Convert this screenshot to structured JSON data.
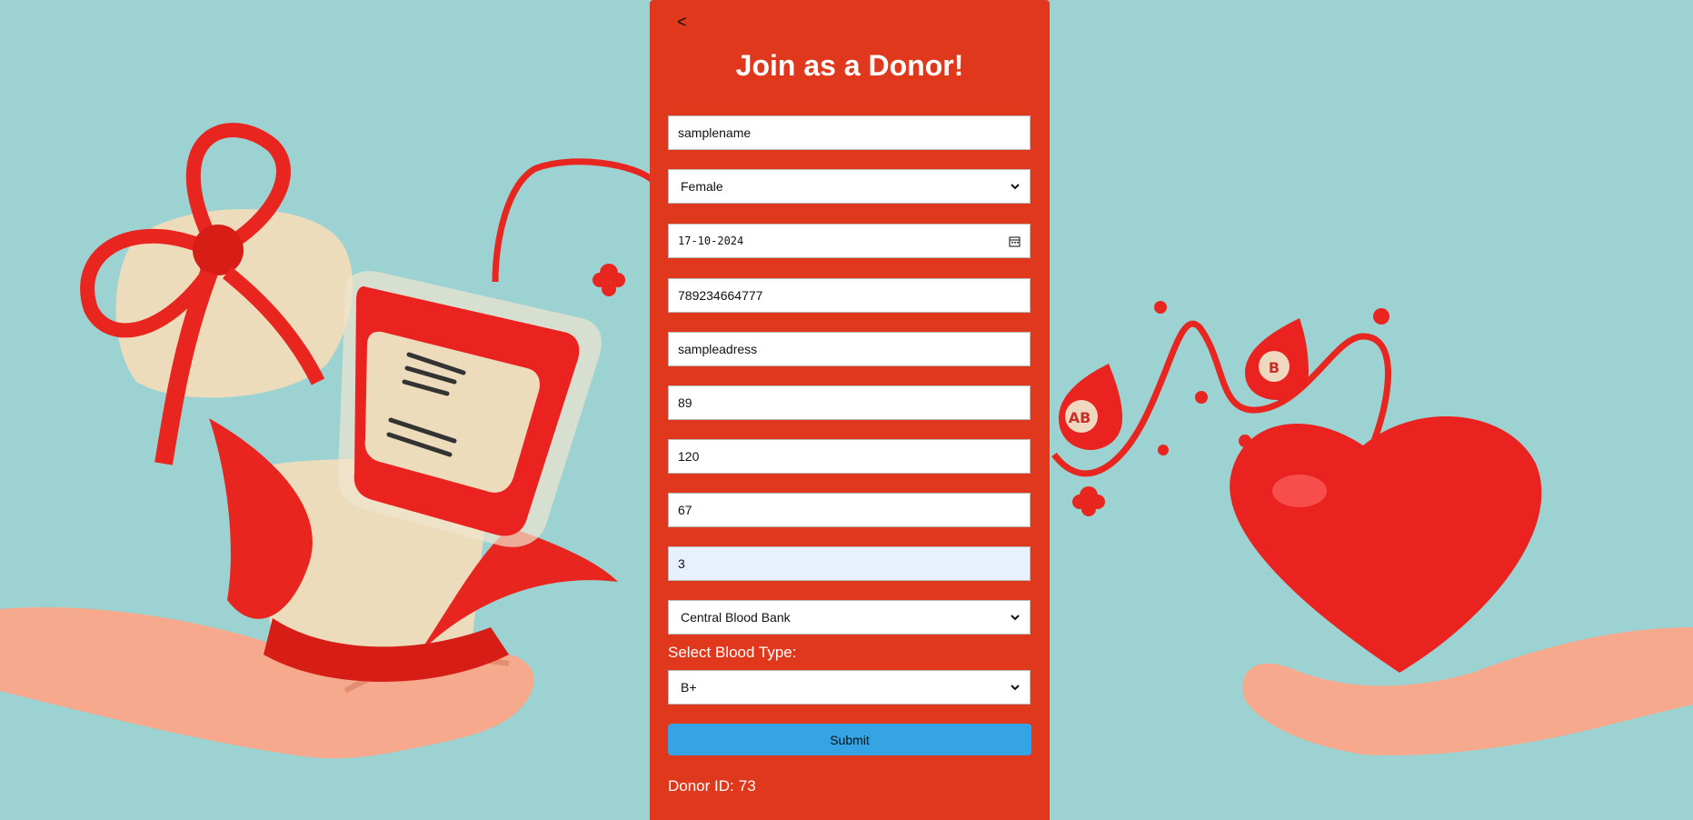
{
  "back_label": "<",
  "title": "Join as a Donor!",
  "form": {
    "name": "samplename",
    "gender": "Female",
    "date": "17-10-2024",
    "phone": "789234664777",
    "address": "sampleadress",
    "field_6": "89",
    "field_7": "120",
    "field_8": "67",
    "field_9": "3",
    "blood_bank": "Central Blood Bank",
    "blood_type_label": "Select Blood Type:",
    "blood_type": "B+",
    "submit_label": "Submit"
  },
  "donor_id": {
    "label": "Donor ID:",
    "value": "73"
  },
  "colors": {
    "background": "#9cd3d2",
    "panel": "#e0381c",
    "submit": "#36a4e4",
    "autofill": "#e8f0fe"
  },
  "icons": {
    "select_arrow": "chevron-down-icon",
    "date_picker": "calendar-icon",
    "back": "back-arrow-icon"
  },
  "background_art": {
    "left_drop_labels": [
      "AB",
      "B"
    ]
  }
}
